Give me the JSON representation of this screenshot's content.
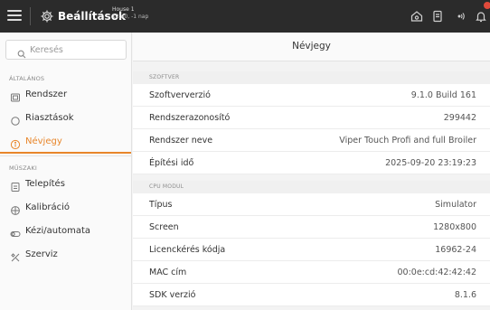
{
  "topbar": {
    "title": "Beállítások",
    "house_name": "House 1",
    "house_status": "12:40, -1 nap",
    "icons": [
      "menu-icon",
      "gear-icon",
      "home-icon",
      "tablet-icon",
      "signal-icon",
      "bell-icon"
    ],
    "notification_color": "#e04a3b"
  },
  "sidebar": {
    "search": {
      "placeholder": "Keresés",
      "value": ""
    },
    "sections": [
      {
        "label": "ÁLTALÁNOS",
        "items": [
          {
            "label": "Rendszer",
            "icon": "system-icon",
            "active": false
          },
          {
            "label": "Riasztások",
            "icon": "alarm-icon",
            "active": false
          },
          {
            "label": "Névjegy",
            "icon": "info-icon",
            "active": true
          }
        ]
      },
      {
        "label": "MŰSZAKI",
        "items": [
          {
            "label": "Telepítés",
            "icon": "install-icon",
            "active": false
          },
          {
            "label": "Kalibráció",
            "icon": "calibration-icon",
            "active": false
          },
          {
            "label": "Kézi/automata",
            "icon": "toggle-icon",
            "active": false
          },
          {
            "label": "Szerviz",
            "icon": "tools-icon",
            "active": false
          }
        ]
      }
    ],
    "accent_color": "#e8862a"
  },
  "main": {
    "title": "Névjegy",
    "groups": [
      {
        "label": "SZOFTVER",
        "rows": [
          {
            "key": "Szoftververzió",
            "value": "9.1.0 Build 161"
          },
          {
            "key": "Rendszerazonosító",
            "value": "299442"
          },
          {
            "key": "Rendszer neve",
            "value": "Viper Touch Profi and full Broiler"
          },
          {
            "key": "Építési idő",
            "value": "2025-09-20 23:19:23"
          }
        ]
      },
      {
        "label": "CPU MODUL",
        "rows": [
          {
            "key": "Típus",
            "value": "Simulator"
          },
          {
            "key": "Screen",
            "value": "1280x800"
          },
          {
            "key": "Licenckérés kódja",
            "value": "16962-24"
          },
          {
            "key": "MAC cím",
            "value": "00:0e:cd:42:42:42"
          },
          {
            "key": "SDK verzió",
            "value": "8.1.6"
          }
        ]
      }
    ]
  }
}
